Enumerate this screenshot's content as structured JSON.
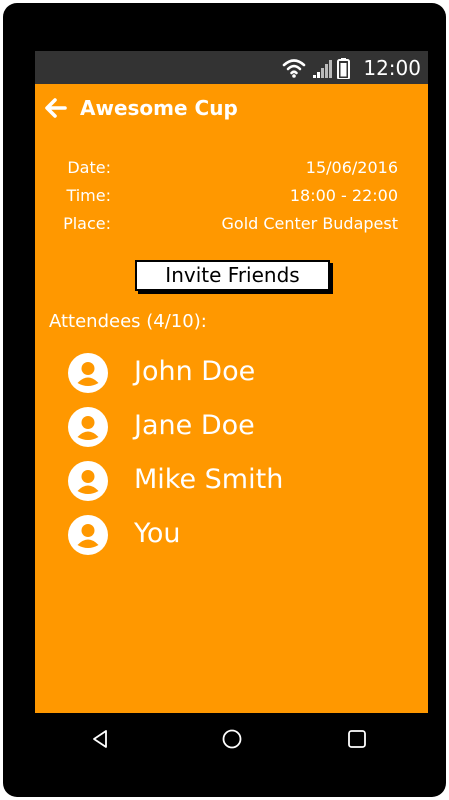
{
  "status_bar": {
    "time": "12:00"
  },
  "header": {
    "title": "Awesome Cup"
  },
  "event": {
    "date_label": "Date:",
    "date_value": "15/06/2016",
    "time_label": "Time:",
    "time_value": "18:00 - 22:00",
    "place_label": "Place:",
    "place_value": "Gold Center Budapest"
  },
  "invite_button": {
    "label": "Invite Friends"
  },
  "attendees": {
    "heading": "Attendees (4/10):",
    "people": [
      {
        "name": "John Doe"
      },
      {
        "name": "Jane Doe"
      },
      {
        "name": "Mike Smith"
      },
      {
        "name": "You"
      }
    ]
  },
  "icons": {
    "back": "arrow-left-icon",
    "avatar": "account-circle-icon",
    "wifi": "wifi-icon",
    "signal": "signal-icon",
    "battery": "battery-icon",
    "nav_back": "triangle-back-icon",
    "nav_home": "circle-home-icon",
    "nav_recent": "square-recent-icon"
  },
  "colors": {
    "screen_background": "#ff9800",
    "status_bar": "#333333",
    "text": "#ffffff",
    "button_background": "#ffffff"
  }
}
